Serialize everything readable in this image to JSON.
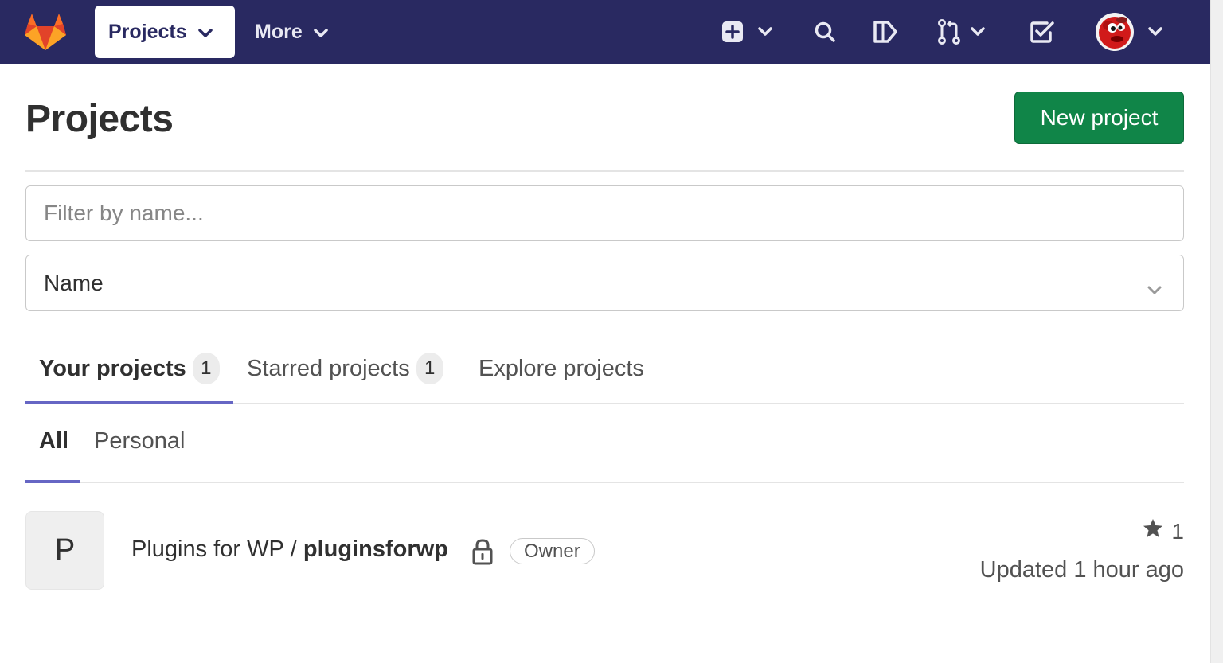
{
  "topbar": {
    "logo_icon": "gitlab-tanuki-icon",
    "projects_label": "Projects",
    "more_label": "More",
    "icons": [
      "new-item-icon",
      "search-icon",
      "issues-icon",
      "merge-requests-icon",
      "todos-icon",
      "user-avatar"
    ],
    "background": "#292961"
  },
  "page": {
    "title": "Projects",
    "new_project_label": "New project",
    "new_project_color": "#108548"
  },
  "filter": {
    "placeholder": "Filter by name...",
    "value": ""
  },
  "sort": {
    "selected": "Name"
  },
  "tabs": [
    {
      "label": "Your projects",
      "count": "1",
      "active": true
    },
    {
      "label": "Starred projects",
      "count": "1",
      "active": false
    },
    {
      "label": "Explore projects",
      "active": false
    }
  ],
  "subtabs": [
    {
      "label": "All",
      "active": true
    },
    {
      "label": "Personal",
      "active": false
    }
  ],
  "projects": [
    {
      "avatar_letter": "P",
      "namespace": "Plugins for WP",
      "separator": "/",
      "name": "pluginsforwp",
      "visibility_icon": "lock-icon",
      "role": "Owner",
      "stars": "1",
      "updated": "Updated 1 hour ago"
    }
  ],
  "accent_color": "#6666c4"
}
